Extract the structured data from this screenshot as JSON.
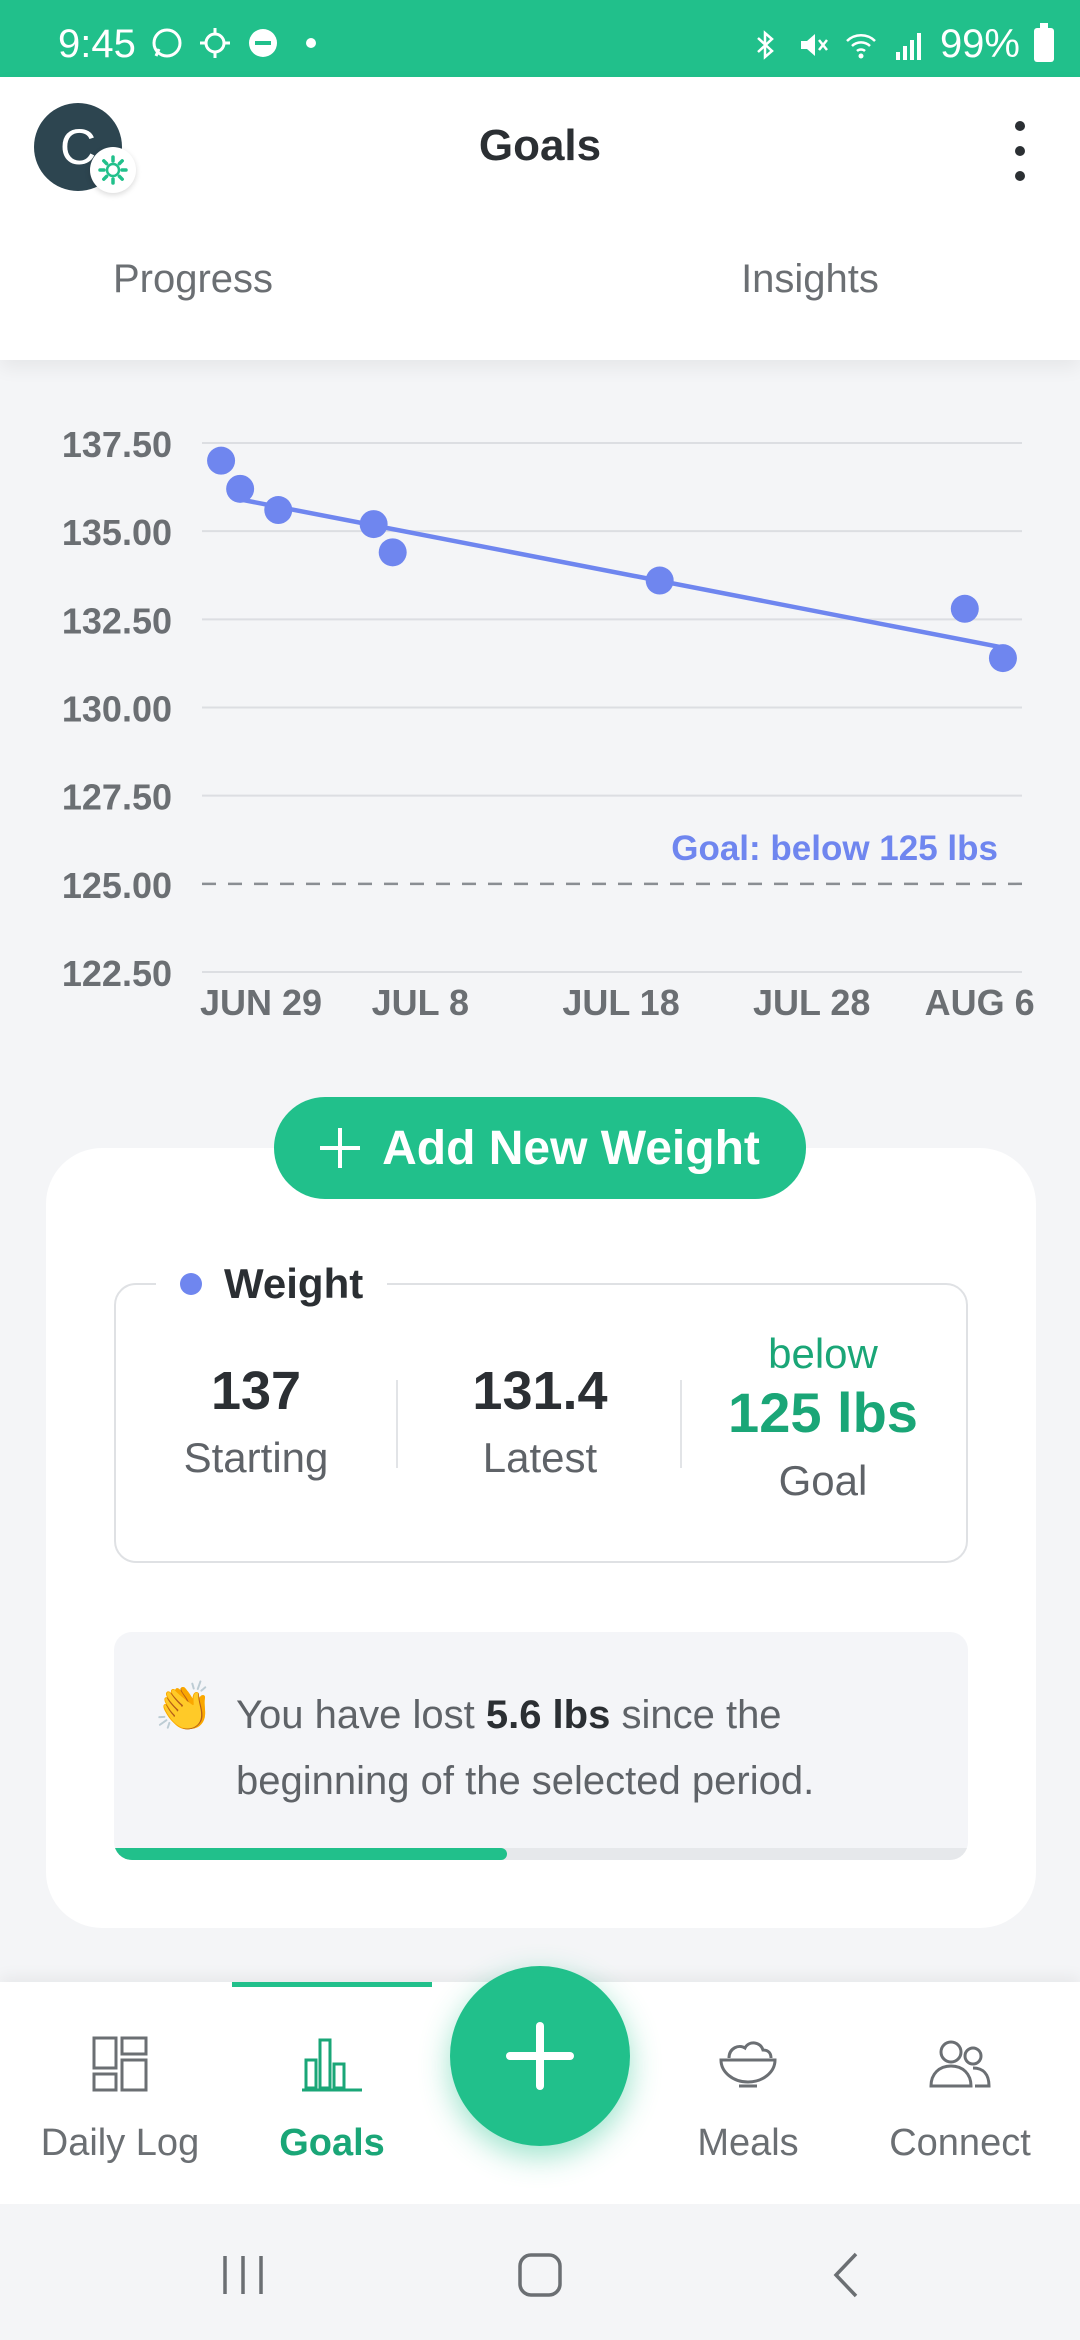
{
  "status_bar": {
    "time": "9:45",
    "battery": "99%",
    "left_icons": [
      "whatsapp-icon",
      "location-icon",
      "do-not-disturb-icon",
      "dot-icon"
    ],
    "right_icons": [
      "bluetooth-icon",
      "mute-icon",
      "wifi-icon",
      "signal-icon",
      "battery-icon"
    ]
  },
  "header": {
    "avatar_initial": "C",
    "title": "Goals",
    "tabs": [
      {
        "label": "Progress"
      },
      {
        "label": "Insights"
      }
    ]
  },
  "chart_data": {
    "type": "scatter",
    "title": "",
    "xlabel": "",
    "ylabel": "",
    "y_ticks": [
      "137.50",
      "135.00",
      "132.50",
      "130.00",
      "127.50",
      "125.00",
      "122.50"
    ],
    "ylim": [
      122.5,
      137.5
    ],
    "x_ticks": [
      "JUN 29",
      "JUL 8",
      "JUL 18",
      "JUL 28",
      "AUG 6"
    ],
    "xlim": [
      "Jun 29",
      "Aug 11"
    ],
    "points": [
      {
        "x": "Jun 30",
        "y": 137.0
      },
      {
        "x": "Jul 1",
        "y": 136.2
      },
      {
        "x": "Jul 3",
        "y": 135.6
      },
      {
        "x": "Jul 8",
        "y": 135.2
      },
      {
        "x": "Jul 9",
        "y": 134.4
      },
      {
        "x": "Jul 23",
        "y": 133.6
      },
      {
        "x": "Aug 8",
        "y": 132.8
      },
      {
        "x": "Aug 10",
        "y": 131.4
      }
    ],
    "trend": [
      {
        "x": "Jul 1",
        "y": 135.9
      },
      {
        "x": "Aug 10",
        "y": 131.7
      }
    ],
    "goal_line": {
      "value": 125,
      "label": "Goal: below 125 lbs"
    },
    "grid": true,
    "series_color": "#6f86ef"
  },
  "card": {
    "add_button_label": "Add New Weight",
    "legend_label": "Weight",
    "starting_value": "137",
    "starting_label": "Starting",
    "latest_value": "131.4",
    "latest_label": "Latest",
    "goal_prefix": "below",
    "goal_value": "125 lbs",
    "goal_label": "Goal",
    "message_pre": "You have lost ",
    "message_bold": "5.6 lbs",
    "message_post": " since the beginning of the selected period.",
    "progress_fraction": 0.46
  },
  "bottom_nav": {
    "items": [
      {
        "label": "Daily Log",
        "icon": "daily-log-icon"
      },
      {
        "label": "Goals",
        "icon": "goals-chart-icon",
        "active": true
      },
      {
        "label": "Meals",
        "icon": "meals-bowl-icon"
      },
      {
        "label": "Connect",
        "icon": "connect-people-icon"
      }
    ]
  },
  "colors": {
    "brand_green": "#21c08b",
    "chart_blue": "#6f86ef",
    "goal_green": "#1aa677"
  }
}
